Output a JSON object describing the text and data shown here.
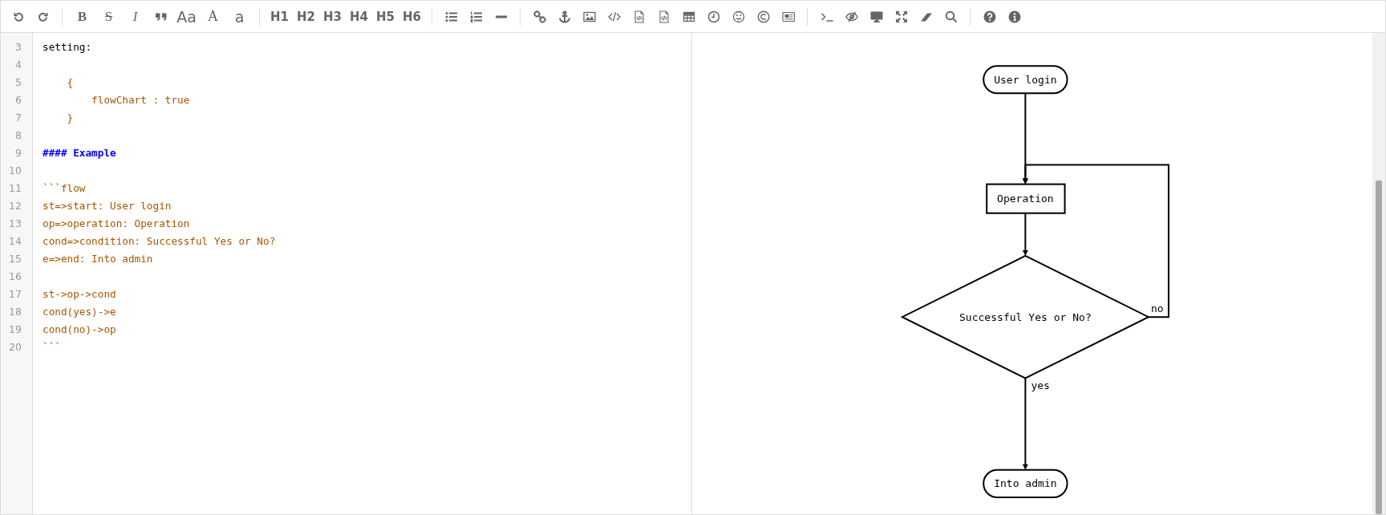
{
  "toolbar": {
    "groups": [
      [
        {
          "kind": "icon"
        },
        {
          "kind": "icon"
        }
      ],
      [
        {
          "kind": "text",
          "label": "B"
        },
        {
          "kind": "text",
          "label": "S"
        },
        {
          "kind": "text",
          "label": "I"
        },
        {
          "kind": "icon"
        },
        {
          "kind": "text",
          "label": "Aa"
        },
        {
          "kind": "text",
          "label": "A"
        },
        {
          "kind": "text",
          "label": "a"
        }
      ],
      [
        {
          "kind": "text",
          "label": "H1"
        },
        {
          "kind": "text",
          "label": "H2"
        },
        {
          "kind": "text",
          "label": "H3"
        },
        {
          "kind": "text",
          "label": "H4"
        },
        {
          "kind": "text",
          "label": "H5"
        },
        {
          "kind": "text",
          "label": "H6"
        }
      ],
      [
        {
          "kind": "icon"
        },
        {
          "kind": "icon"
        },
        {
          "kind": "icon"
        }
      ],
      [
        {
          "kind": "icon"
        },
        {
          "kind": "icon"
        },
        {
          "kind": "icon"
        },
        {
          "kind": "icon"
        },
        {
          "kind": "icon"
        },
        {
          "kind": "icon"
        },
        {
          "kind": "icon"
        },
        {
          "kind": "icon"
        },
        {
          "kind": "icon"
        },
        {
          "kind": "icon"
        },
        {
          "kind": "icon"
        }
      ],
      [
        {
          "kind": "icon"
        },
        {
          "kind": "icon"
        },
        {
          "kind": "icon"
        },
        {
          "kind": "icon"
        },
        {
          "kind": "icon"
        },
        {
          "kind": "icon"
        }
      ],
      [
        {
          "kind": "icon"
        },
        {
          "kind": "icon"
        }
      ]
    ]
  },
  "editor": {
    "lines": [
      {
        "number": "3",
        "kind": "plain",
        "text": "setting:"
      },
      {
        "number": "4"
      },
      {
        "number": "5",
        "kind": "string",
        "text": "    {"
      },
      {
        "number": "6",
        "kind": "string",
        "text": "        flowChart : true"
      },
      {
        "number": "7",
        "kind": "string",
        "text": "    }"
      },
      {
        "number": "8"
      },
      {
        "number": "9",
        "kind": "header",
        "text": "#### Example"
      },
      {
        "number": "10"
      },
      {
        "number": "11",
        "kind": "string",
        "text": "```flow"
      },
      {
        "number": "12",
        "kind": "string",
        "text": "st=>start: User login"
      },
      {
        "number": "13",
        "kind": "string",
        "text": "op=>operation: Operation"
      },
      {
        "number": "14",
        "kind": "string",
        "text": "cond=>condition: Successful Yes or No?"
      },
      {
        "number": "15",
        "kind": "string",
        "text": "e=>end: Into admin"
      },
      {
        "number": "16"
      },
      {
        "number": "17",
        "kind": "string",
        "text": "st->op->cond"
      },
      {
        "number": "18",
        "kind": "string",
        "text": "cond(yes)->e"
      },
      {
        "number": "19",
        "kind": "string",
        "text": "cond(no)->op"
      },
      {
        "number": "20",
        "kind": "string",
        "text": "```"
      }
    ]
  },
  "preview": {
    "flowchart": {
      "nodes": [
        {
          "kind": "start",
          "label": "User login"
        },
        {
          "kind": "operation",
          "label": "Operation"
        },
        {
          "kind": "condition",
          "label": "Successful Yes or No?"
        },
        {
          "kind": "end",
          "label": "Into admin"
        }
      ],
      "edges": [
        {
          "kind": "forward"
        },
        {
          "kind": "forward"
        },
        {
          "kind": "forward",
          "label": "yes"
        },
        {
          "kind": "loop",
          "label": "no"
        }
      ]
    }
  }
}
